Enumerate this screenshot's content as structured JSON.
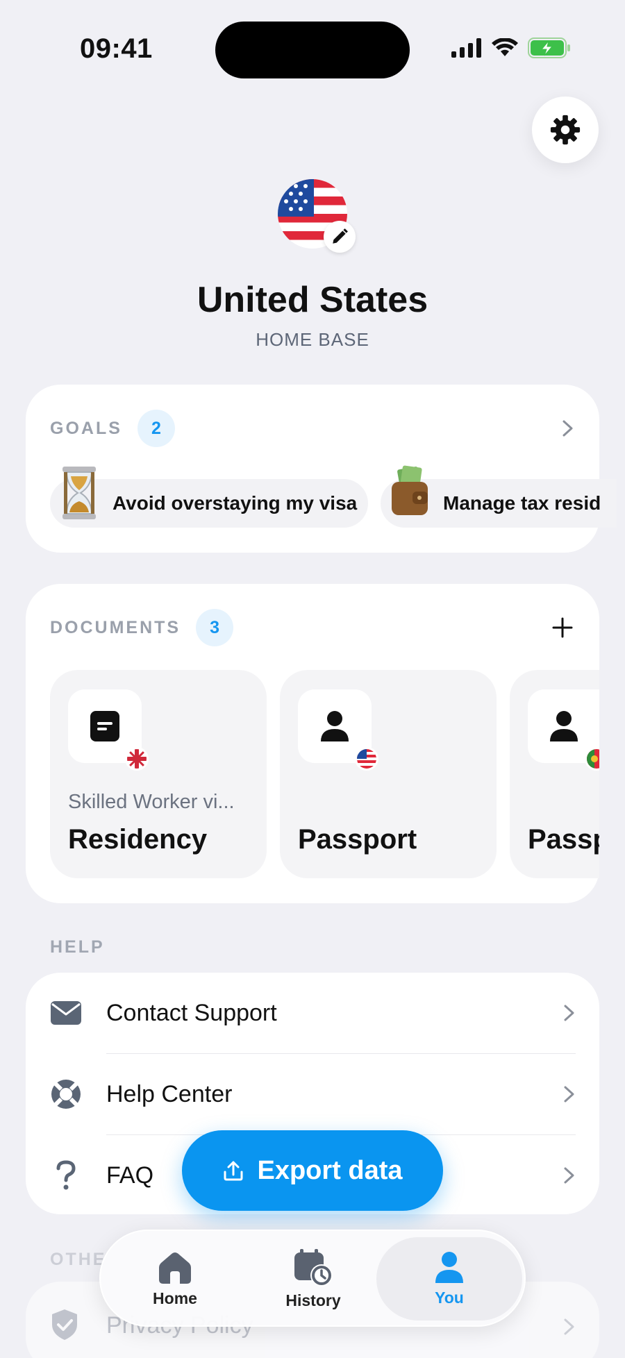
{
  "status_bar": {
    "time": "09:41"
  },
  "profile": {
    "country": "United States",
    "subtitle": "HOME BASE"
  },
  "goals": {
    "title": "GOALS",
    "count": "2",
    "items": [
      {
        "label": "Avoid overstaying my visa",
        "icon": "hourglass-emoji"
      },
      {
        "label": "Manage tax resid",
        "icon": "wallet-emoji"
      }
    ]
  },
  "documents": {
    "title": "DOCUMENTS",
    "count": "3",
    "items": [
      {
        "subtitle": "Skilled Worker vi...",
        "title": "Residency",
        "icon": "document-icon",
        "flag": "uk-flag"
      },
      {
        "subtitle": "",
        "title": "Passport",
        "icon": "person-icon",
        "flag": "us-flag"
      },
      {
        "subtitle": "",
        "title": "Passp",
        "icon": "person-icon",
        "flag": "portugal-flag"
      }
    ]
  },
  "help": {
    "title": "HELP",
    "items": [
      {
        "label": "Contact Support",
        "icon": "envelope-icon"
      },
      {
        "label": "Help Center",
        "icon": "lifebuoy-icon"
      },
      {
        "label": "FAQ",
        "icon": "question-icon"
      }
    ]
  },
  "other": {
    "title": "OTHE",
    "items": [
      {
        "label": "Privacy Policy",
        "icon": "shield-check-icon"
      }
    ]
  },
  "export_button": {
    "label": "Export data"
  },
  "tab_bar": {
    "tabs": [
      {
        "label": "Home",
        "icon": "home-icon",
        "active": false
      },
      {
        "label": "History",
        "icon": "calendar-clock-icon",
        "active": false
      },
      {
        "label": "You",
        "icon": "person-icon",
        "active": true
      }
    ]
  },
  "colors": {
    "accent": "#0a95f0",
    "background": "#f0f0f5",
    "card": "#ffffff",
    "muted_text": "#9aa0ab"
  }
}
